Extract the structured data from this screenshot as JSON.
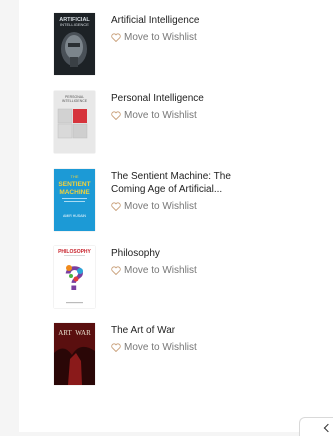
{
  "books": [
    {
      "title": "Artificial Intelligence",
      "wishlist_label": "Move to Wishlist",
      "cover": {
        "icon": "book-cover-artificial-intelligence",
        "bg": "#1d2226",
        "text_lines": [
          "ARTIFICIAL",
          "INTELLIGENCE"
        ]
      }
    },
    {
      "title": "Personal Intelligence",
      "wishlist_label": "Move to Wishlist",
      "cover": {
        "icon": "book-cover-personal-intelligence",
        "bg": "#e8e8e8",
        "accent": "#d6343c",
        "text_lines": [
          "PERSONAL",
          "INTELLIGENCE"
        ]
      }
    },
    {
      "title": "The Sentient Machine: The",
      "title_line2": "Coming Age of Artificial...",
      "wishlist_label": "Move to Wishlist",
      "cover": {
        "icon": "book-cover-sentient-machine",
        "bg": "#1c9ad6",
        "accent": "#f2d23a",
        "text_lines": [
          "THE",
          "SENTIENT",
          "MACHINE",
          "AMIR HUSAIN"
        ]
      }
    },
    {
      "title": "Philosophy",
      "wishlist_label": "Move to Wishlist",
      "cover": {
        "icon": "book-cover-philosophy",
        "bg": "#ffffff",
        "accent": "#c8232c",
        "text_lines": [
          "PHILOSOPHY",
          "?"
        ]
      }
    },
    {
      "title": "The Art of War",
      "wishlist_label": "Move to Wishlist",
      "cover": {
        "icon": "book-cover-art-of-war",
        "bg": "#5a0f0f",
        "accent": "#e9e2d0",
        "text_lines": [
          "ART",
          "WAR"
        ]
      }
    }
  ],
  "colors": {
    "heart": "#c9a07a",
    "text": "#222222",
    "muted": "#777777"
  },
  "corner_button_icon": "chevron-down-icon"
}
